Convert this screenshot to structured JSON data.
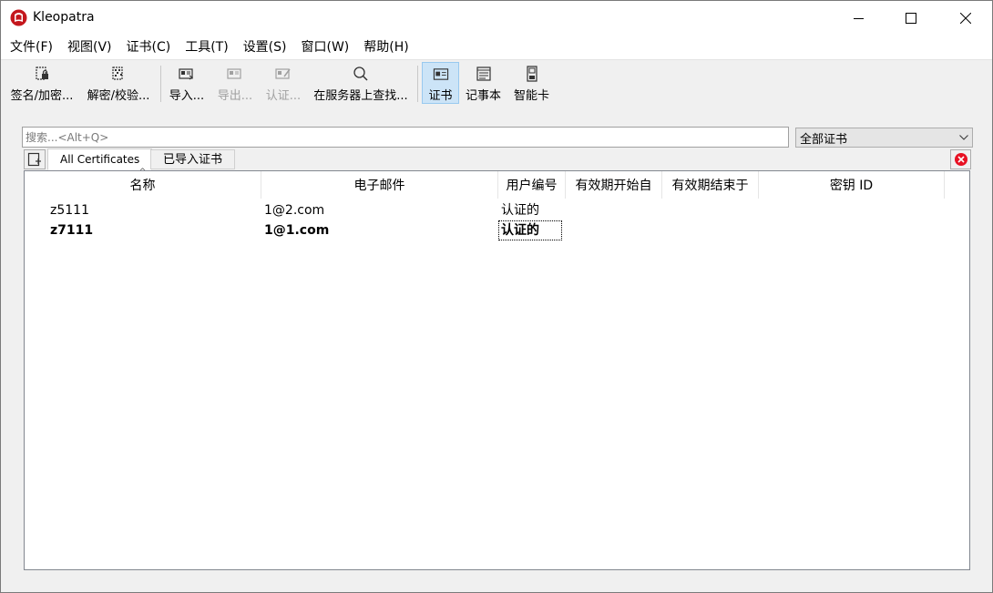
{
  "window": {
    "title": "Kleopatra"
  },
  "menubar": {
    "items": [
      "文件(F)",
      "视图(V)",
      "证书(C)",
      "工具(T)",
      "设置(S)",
      "窗口(W)",
      "帮助(H)"
    ]
  },
  "toolbar": {
    "sign_encrypt": "签名/加密...",
    "decrypt_verify": "解密/校验...",
    "import": "导入...",
    "export": "导出...",
    "certify": "认证...",
    "lookup_server": "在服务器上查找...",
    "certificates": "证书",
    "notepad": "记事本",
    "smartcard": "智能卡"
  },
  "search": {
    "placeholder": "搜索...<Alt+Q>",
    "value": ""
  },
  "filter": {
    "selected": "全部证书"
  },
  "tabs": [
    {
      "label": "All Certificates",
      "active": true
    },
    {
      "label": "已导入证书",
      "active": false
    }
  ],
  "table": {
    "columns": [
      "名称",
      "电子邮件",
      "用户编号",
      "有效期开始自",
      "有效期结束于",
      "密钥 ID"
    ],
    "sorted_column": "名称",
    "rows": [
      {
        "name": "z5111",
        "email": "1@2.com",
        "user_id": "认证的",
        "valid_from": "",
        "valid_until": "",
        "key_id": "",
        "bold": false
      },
      {
        "name": "z7111",
        "email": "1@1.com",
        "user_id": "认证的",
        "valid_from": "",
        "valid_until": "",
        "key_id": "",
        "bold": true
      }
    ]
  },
  "colors": {
    "accent": "#cce4f7",
    "close_red": "#e81123"
  }
}
